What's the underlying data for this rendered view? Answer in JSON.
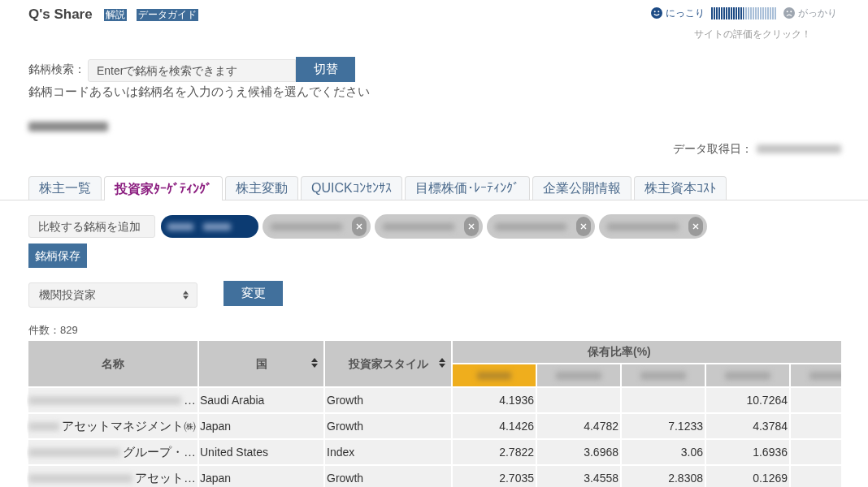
{
  "header": {
    "title": "Q's Share",
    "badges": [
      "解説",
      "データガイド"
    ]
  },
  "rating": {
    "good_label": "にっこり",
    "level": 0.5,
    "bad_label": "がっかり",
    "caption": "サイトの評価をクリック！"
  },
  "search": {
    "label": "銘柄検索：",
    "placeholder": "Enterで銘柄を検索できます",
    "button": "切替",
    "hint": "銘柄コードあるいは銘柄名を入力のうえ候補を選んでください"
  },
  "data_date_label": "データ取得日：",
  "tabs": [
    {
      "label": "株主一覧",
      "selected": false
    },
    {
      "label": "投資家ﾀｰｹﾞﾃｨﾝｸﾞ",
      "selected": true
    },
    {
      "label": "株主変動",
      "selected": false
    },
    {
      "label": "QUICKｺﾝｾﾝｻｽ",
      "selected": false
    },
    {
      "label": "目標株価･ﾚｰﾃｨﾝｸﾞ",
      "selected": false
    },
    {
      "label": "企業公開情報",
      "selected": false
    },
    {
      "label": "株主資本ｺｽﾄ",
      "selected": false
    }
  ],
  "compare": {
    "add_button": "比較する銘柄を追加",
    "chips": [
      {
        "selected": true
      },
      {
        "selected": false
      },
      {
        "selected": false
      },
      {
        "selected": false
      },
      {
        "selected": false
      }
    ],
    "save_button": "銘柄保存"
  },
  "filter": {
    "value": "機関投資家",
    "button": "変更"
  },
  "count": "件数：829",
  "table": {
    "columns": [
      {
        "label": "名称",
        "sortable": false
      },
      {
        "label": "国",
        "sortable": true
      },
      {
        "label": "投資家スタイル",
        "sortable": true
      }
    ],
    "group_header": "保有比率(%)",
    "compare_columns": [
      {
        "highlighted": true
      },
      {
        "highlighted": false
      },
      {
        "highlighted": false
      },
      {
        "highlighted": false
      },
      {
        "highlighted": false
      }
    ],
    "rows": [
      {
        "name": "…",
        "country": "Saudi Arabia",
        "style": "Growth",
        "holdings": [
          {
            "kind": "value",
            "value": "4.1936"
          },
          {
            "kind": "blank"
          },
          {
            "kind": "blank"
          },
          {
            "kind": "value",
            "value": "10.7264"
          }
        ]
      },
      {
        "name": "アセットマネジメント㈱",
        "country": "Japan",
        "style": "Growth",
        "holdings": [
          {
            "kind": "value",
            "value": "4.1426"
          },
          {
            "kind": "value",
            "value": "4.4782"
          },
          {
            "kind": "value",
            "value": "7.1233"
          },
          {
            "kind": "value",
            "value": "4.3784"
          }
        ]
      },
      {
        "name": "グループ・…",
        "country": "United States",
        "style": "Index",
        "holdings": [
          {
            "kind": "value",
            "value": "2.7822"
          },
          {
            "kind": "value",
            "value": "3.6968"
          },
          {
            "kind": "value",
            "value": "3.06"
          },
          {
            "kind": "value",
            "value": "1.6936"
          }
        ]
      },
      {
        "name": "アセット…",
        "country": "Japan",
        "style": "Growth",
        "holdings": [
          {
            "kind": "value",
            "value": "2.7035"
          },
          {
            "kind": "value",
            "value": "3.4558"
          },
          {
            "kind": "value",
            "value": "2.8308"
          },
          {
            "kind": "value",
            "value": "0.1269"
          }
        ]
      }
    ]
  }
}
